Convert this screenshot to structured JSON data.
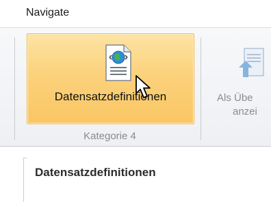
{
  "titlebar": {
    "title": "Navigate"
  },
  "ribbon": {
    "main_button": {
      "label": "Datensatzdefinitionen",
      "icon": "web-document-icon"
    },
    "group_label": "Kategorie 4",
    "second_button": {
      "line1": "Als Übe",
      "line2": "anzei",
      "icon": "arrow-document-icon"
    }
  },
  "panel": {
    "title": "Datensatzdefinitionen"
  },
  "colors": {
    "button_highlight": "#fac663",
    "button_border": "#f0b54a",
    "group_label": "#8a8a8a"
  }
}
